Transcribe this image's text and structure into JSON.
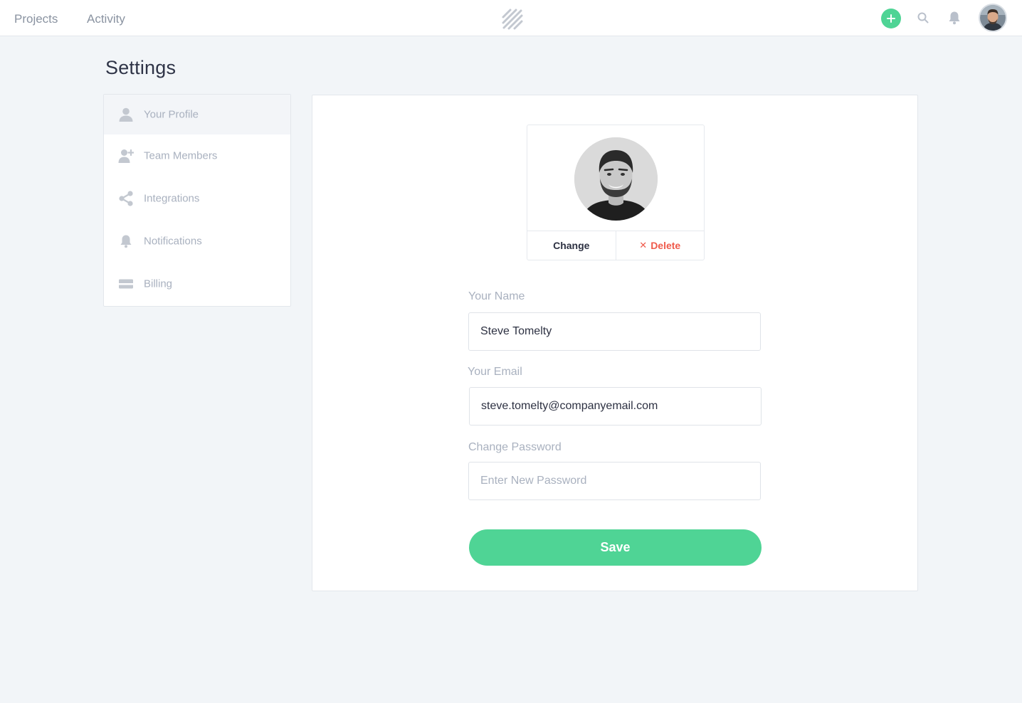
{
  "nav": {
    "projects": "Projects",
    "activity": "Activity",
    "logo_icon": "diagonal-stripes-logo",
    "add_icon": "plus-icon",
    "search_icon": "search-icon",
    "bell_icon": "bell-icon"
  },
  "page": {
    "title": "Settings"
  },
  "sidebar": {
    "items": [
      {
        "label": "Your Profile",
        "icon": "user-icon",
        "active": true
      },
      {
        "label": "Team Members",
        "icon": "add-user-icon",
        "active": false
      },
      {
        "label": "Integrations",
        "icon": "share-icon",
        "active": false
      },
      {
        "label": "Notifications",
        "icon": "bell-icon",
        "active": false
      },
      {
        "label": "Billing",
        "icon": "credit-card-icon",
        "active": false
      }
    ]
  },
  "profile": {
    "change_label": "Change",
    "delete_label": "Delete",
    "name_label": "Your Name",
    "name_value": "Steve Tomelty",
    "email_label": "Your Email",
    "email_value": "steve.tomelty@companyemail.com",
    "password_label": "Change Password",
    "password_placeholder": "Enter New Password",
    "save_label": "Save"
  },
  "colors": {
    "accent": "#4fd495",
    "danger": "#ef5a4b",
    "muted": "#a9b1bf",
    "background": "#f2f5f8"
  }
}
